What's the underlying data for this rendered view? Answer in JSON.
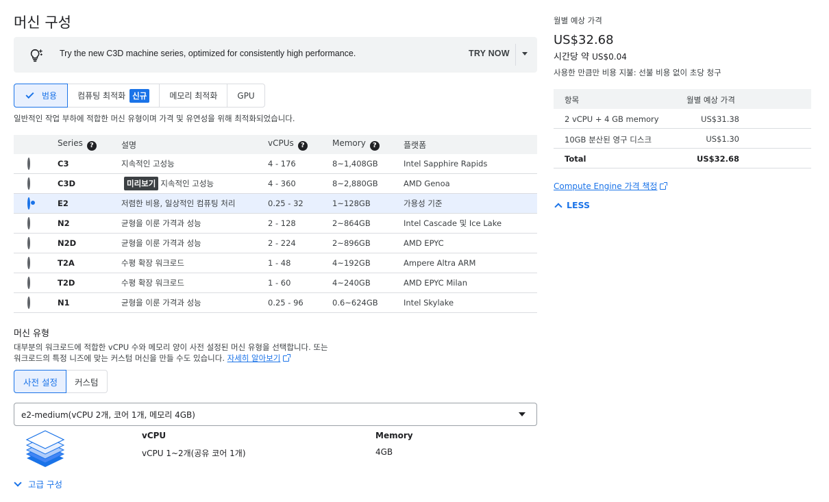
{
  "page_title": "머신 구성",
  "banner": {
    "icon": "lightbulb-sparkle-icon",
    "message": "Try the new C3D machine series, optimized for consistently high performance.",
    "action": "TRY NOW"
  },
  "series_tabs": [
    {
      "label": "범용",
      "active": true
    },
    {
      "label": "컴퓨팅 최적화",
      "badge": "신규"
    },
    {
      "label": "메모리 최적화"
    },
    {
      "label": "GPU"
    }
  ],
  "series_description": "일반적인 작업 부하에 적합한 머신 유형이며 가격 및 유연성을 위해 최적화되었습니다.",
  "table": {
    "headers": {
      "series": "Series",
      "desc": "설명",
      "vcpus": "vCPUs",
      "memory": "Memory",
      "platform": "플랫폼"
    },
    "rows": [
      {
        "series": "C3",
        "desc": "지속적인 고성능",
        "vcpus": "4 - 176",
        "memory": "8~1,408GB",
        "platform": "Intel Sapphire Rapids"
      },
      {
        "series": "C3D",
        "badge": "미리보기",
        "desc": "지속적인 고성능",
        "vcpus": "4 - 360",
        "memory": "8~2,880GB",
        "platform": "AMD Genoa"
      },
      {
        "series": "E2",
        "desc": "저렴한 비용, 일상적인 컴퓨팅 처리",
        "vcpus": "0.25 - 32",
        "memory": "1~128GB",
        "platform": "가용성 기준",
        "selected": true
      },
      {
        "series": "N2",
        "desc": "균형을 이룬 가격과 성능",
        "vcpus": "2 - 128",
        "memory": "2~864GB",
        "platform": "Intel Cascade 및 Ice Lake"
      },
      {
        "series": "N2D",
        "desc": "균형을 이룬 가격과 성능",
        "vcpus": "2 - 224",
        "memory": "2~896GB",
        "platform": "AMD EPYC"
      },
      {
        "series": "T2A",
        "desc": "수평 확장 워크로드",
        "vcpus": "1 - 48",
        "memory": "4~192GB",
        "platform": "Ampere Altra ARM"
      },
      {
        "series": "T2D",
        "desc": "수평 확장 워크로드",
        "vcpus": "1 - 60",
        "memory": "4~240GB",
        "platform": "AMD EPYC Milan"
      },
      {
        "series": "N1",
        "desc": "균형을 이룬 가격과 성능",
        "vcpus": "0.25 - 96",
        "memory": "0.6~624GB",
        "platform": "Intel Skylake"
      }
    ]
  },
  "machine_type": {
    "title": "머신 유형",
    "desc_line1": "대부분의 워크로드에 적합한 vCPU 수와 메모리 양이 사전 설정된 머신 유형을 선택합니다. 또는",
    "desc_line2": "워크로드의 특정 니즈에 맞는 커스텀 머신을 만들 수도 있습니다.",
    "learn_more": "자세히 알아보기",
    "tabs": [
      {
        "label": "사전 설정",
        "active": true
      },
      {
        "label": "커스텀"
      }
    ],
    "selected": "e2-medium(vCPU 2개, 코어 1개, 메모리 4GB)",
    "spec": {
      "icon": "stacked-layers-icon",
      "vcpu_label": "vCPU",
      "vcpu_value": "vCPU 1~2개(공유 코어 1개)",
      "memory_label": "Memory",
      "memory_value": "4GB"
    },
    "advanced": "고급 구성"
  },
  "pricing": {
    "label": "월별 예상 가격",
    "price": "US$32.68",
    "hourly_prefix": "시간당 약",
    "hourly_value": "US$0.04",
    "note": "사용한 만큼만 비용 지불: 선불 비용 없이 초당 청구",
    "headers": {
      "item": "항목",
      "price": "월별 예상 가격"
    },
    "rows": [
      {
        "item": "2 vCPU + 4 GB memory",
        "price": "US$31.38"
      },
      {
        "item": "10GB 분산된 영구 디스크",
        "price": "US$1.30"
      },
      {
        "item": "Total",
        "price": "US$32.68",
        "total": true
      }
    ],
    "link": "Compute Engine 가격 책정",
    "less": "LESS"
  },
  "colors": {
    "accent": "#1a73e8",
    "selected_bg": "#e8f0fe",
    "banner_bg": "#f1f3f4"
  }
}
